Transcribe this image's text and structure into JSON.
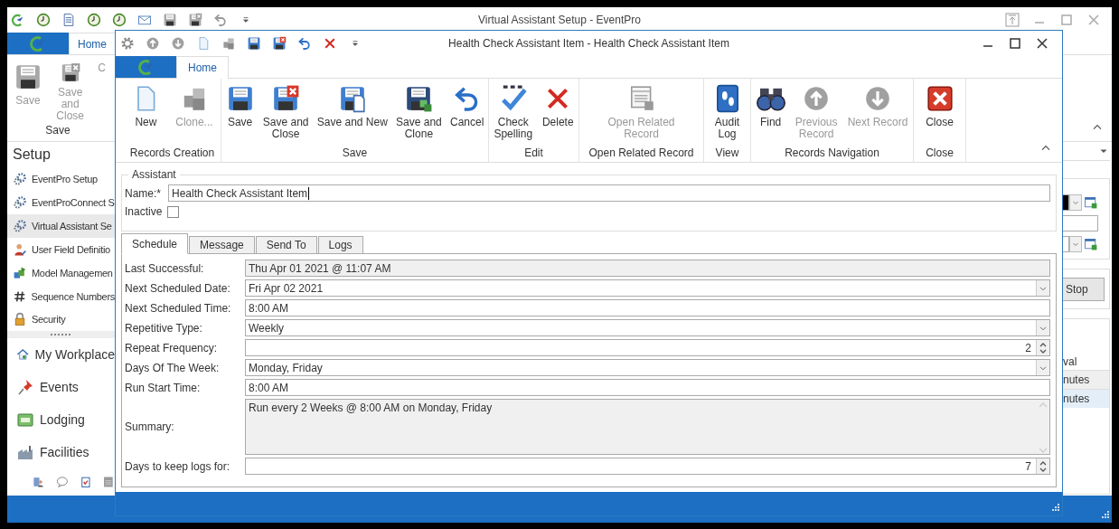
{
  "main_window": {
    "title": "Virtual Assistant Setup - EventPro",
    "ribbon": {
      "tabs": [
        {
          "label": "Home",
          "selected": true
        }
      ],
      "groups": [
        {
          "label": "Save",
          "buttons": [
            {
              "label": "Save",
              "disabled": true
            },
            {
              "label": "Save and\nClose",
              "disabled": true
            },
            {
              "label": "C",
              "disabled": true
            }
          ]
        }
      ]
    },
    "nav": {
      "header": "Setup",
      "items": [
        {
          "label": "EventPro Setup",
          "selected": false
        },
        {
          "label": "EventProConnect S",
          "selected": false
        },
        {
          "label": "Virtual Assistant Se",
          "selected": true
        },
        {
          "label": "User Field Definitio",
          "selected": false
        },
        {
          "label": "Model Managemen",
          "selected": false
        },
        {
          "label": "Sequence Numbers",
          "selected": false
        },
        {
          "label": "Security",
          "selected": false
        }
      ],
      "modules": [
        "My Workplace",
        "Events",
        "Lodging",
        "Facilities"
      ]
    },
    "right_panel": {
      "stop_button": "Stop",
      "grid": {
        "column_header": "val",
        "rows": [
          {
            "text": "nutes",
            "selected": false
          },
          {
            "text": "nutes",
            "selected": true
          }
        ]
      }
    }
  },
  "dialog": {
    "title": "Health Check Assistant Item - Health Check Assistant Item",
    "ribbon": {
      "tabs": [
        {
          "label": "Home",
          "selected": true
        }
      ],
      "groups": [
        {
          "label": "Records Creation",
          "buttons": [
            {
              "label": "New",
              "disabled": false
            },
            {
              "label": "Clone...",
              "disabled": true
            }
          ]
        },
        {
          "label": "Save",
          "buttons": [
            {
              "label": "Save",
              "disabled": false
            },
            {
              "label": "Save and\nClose",
              "disabled": false
            },
            {
              "label": "Save and New",
              "disabled": false
            },
            {
              "label": "Save and\nClone",
              "disabled": false
            },
            {
              "label": "Cancel",
              "disabled": false
            }
          ]
        },
        {
          "label": "Edit",
          "buttons": [
            {
              "label": "Check\nSpelling",
              "disabled": false
            },
            {
              "label": "Delete",
              "disabled": false
            }
          ]
        },
        {
          "label": "Open Related Record",
          "buttons": [
            {
              "label": "Open Related\nRecord",
              "disabled": true
            }
          ]
        },
        {
          "label": "View",
          "buttons": [
            {
              "label": "Audit\nLog",
              "disabled": false
            }
          ]
        },
        {
          "label": "Records Navigation",
          "buttons": [
            {
              "label": "Find",
              "disabled": false
            },
            {
              "label": "Previous\nRecord",
              "disabled": true
            },
            {
              "label": "Next Record",
              "disabled": true
            }
          ]
        },
        {
          "label": "Close",
          "buttons": [
            {
              "label": "Close",
              "disabled": false
            }
          ]
        }
      ]
    },
    "assistant": {
      "legend": "Assistant",
      "name_label": "Name:*",
      "name_value": "Health Check Assistant Item",
      "inactive_label": "Inactive",
      "inactive": false
    },
    "tabs": [
      {
        "label": "Schedule",
        "selected": true
      },
      {
        "label": "Message",
        "selected": false
      },
      {
        "label": "Send To",
        "selected": false
      },
      {
        "label": "Logs",
        "selected": false
      }
    ],
    "fields": [
      {
        "label": "Last Successful:",
        "kind": "readonly",
        "value": "Thu Apr 01 2021 @ 11:07 AM"
      },
      {
        "label": "Next Scheduled Date:",
        "kind": "combo",
        "value": "Fri Apr 02 2021"
      },
      {
        "label": "Next Scheduled Time:",
        "kind": "text",
        "value": "8:00 AM"
      },
      {
        "label": "Repetitive Type:",
        "kind": "combo",
        "value": "Weekly"
      },
      {
        "label": "Repeat Frequency:",
        "kind": "spin",
        "value": "2"
      },
      {
        "label": "Days Of The Week:",
        "kind": "combo",
        "value": "Monday, Friday"
      },
      {
        "label": "Run Start Time:",
        "kind": "text",
        "value": "8:00 AM"
      },
      {
        "label": "Summary:",
        "kind": "memo",
        "value": "Run every 2 Weeks @ 8:00 AM on Monday, Friday"
      },
      {
        "label": "Days to keep logs for:",
        "kind": "spin",
        "value": "7"
      }
    ]
  }
}
